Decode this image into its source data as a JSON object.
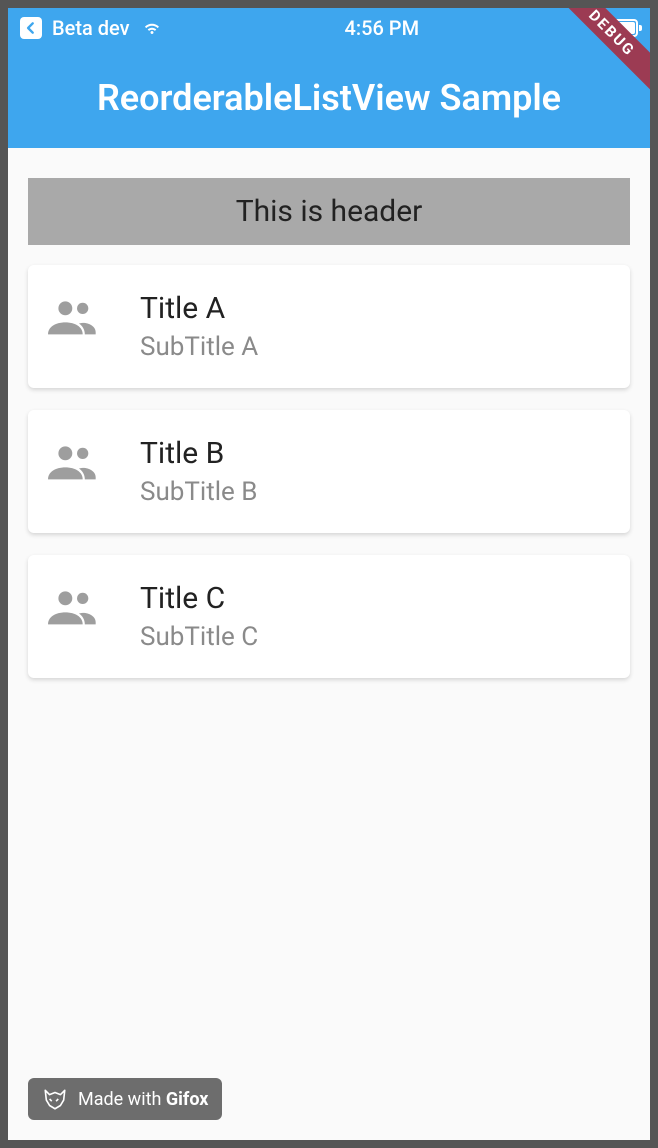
{
  "status_bar": {
    "back_label": "Beta dev",
    "time": "4:56 PM"
  },
  "debug_banner": "DEBUG",
  "app_bar": {
    "title": "ReorderableListView Sample"
  },
  "list": {
    "header": "This is header",
    "items": [
      {
        "title": "Title A",
        "subtitle": "SubTitle A"
      },
      {
        "title": "Title B",
        "subtitle": "SubTitle B"
      },
      {
        "title": "Title C",
        "subtitle": "SubTitle C"
      }
    ]
  },
  "watermark": {
    "prefix": "Made with ",
    "brand": "Gifox"
  }
}
